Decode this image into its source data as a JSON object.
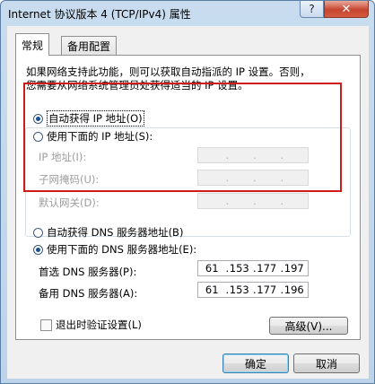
{
  "window": {
    "title": "Internet 协议版本 4 (TCP/IPv4) 属性",
    "help_label": "?",
    "close_label": "✕"
  },
  "tabs": [
    {
      "label": "常规",
      "active": true
    },
    {
      "label": "备用配置",
      "active": false
    }
  ],
  "description_line1": "如果网络支持此功能，则可以获取自动指派的 IP 设置。否则，",
  "description_line2": "您需要从网络系统管理员处获得适当的 IP 设置。",
  "ip_mode": {
    "auto_label": "自动获得 IP 地址(O)",
    "manual_label": "使用下面的 IP 地址(S):",
    "selected": "auto"
  },
  "ip_fields": [
    {
      "label": "IP 地址(I):"
    },
    {
      "label": "子网掩码(U):"
    },
    {
      "label": "默认网关(D):"
    }
  ],
  "dns_mode": {
    "auto_label": "自动获得 DNS 服务器地址(B)",
    "manual_label": "使用下面的 DNS 服务器地址(E):",
    "selected": "manual"
  },
  "dns_fields": [
    {
      "label": "首选 DNS 服务器(P):",
      "octets": [
        "61",
        "153",
        "177",
        "197"
      ]
    },
    {
      "label": "备用 DNS 服务器(A):",
      "octets": [
        "61",
        "153",
        "177",
        "196"
      ]
    }
  ],
  "validate_on_exit": {
    "label": "退出时验证设置(L)",
    "checked": false
  },
  "advanced_button": "高级(V)...",
  "ok_button": "确定",
  "cancel_button": "取消",
  "colors": {
    "highlight_box": "#d11a1a",
    "title_bar": "#c9dcef"
  }
}
